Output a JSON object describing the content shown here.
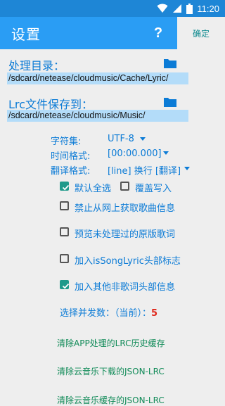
{
  "status_bar": {
    "time": "11:20",
    "icons": [
      "wifi-icon",
      "signal-icon",
      "battery-icon"
    ]
  },
  "toolbar": {
    "title": "设置",
    "help_symbol": "?",
    "confirm_label": "确定"
  },
  "paths": {
    "process_dir_label": "处理目录：",
    "process_dir_value": "/sdcard/netease/cloudmusic/Cache/Lyric/",
    "save_dir_label": "Lrc文件保存到：",
    "save_dir_value": "/sdcard/netease/cloudmusic/Music/"
  },
  "settings": {
    "charset_label": "字符集:",
    "charset_value": "UTF-8",
    "time_format_label": "时间格式:",
    "time_format_value": "[00:00.000]",
    "translation_format_label": "翻译格式:",
    "translation_format_value": "[line] 换行 [翻译]"
  },
  "checkboxes": {
    "select_all": {
      "label": "默认全选",
      "checked": true
    },
    "overwrite": {
      "label": "覆盖写入",
      "checked": false
    },
    "no_online_fetch": {
      "label": "禁止从网上获取歌曲信息",
      "checked": false
    },
    "preview_raw": {
      "label": "预览未处理过的原版歌词",
      "checked": false
    },
    "is_song_lyric_header": {
      "label": "加入isSongLyric头部标志",
      "checked": false
    },
    "extra_header": {
      "label": "加入其他非歌词头部信息",
      "checked": true
    }
  },
  "concurrency": {
    "label": "选择并发数：（当前）：",
    "value": "5"
  },
  "actions": {
    "clear_app_cache": "清除APP处理的LRC历史缓存",
    "clear_downloaded_json_lrc": "清除云音乐下载的JSON-LRC",
    "clear_cached_json_lrc": "清除云音乐缓存的JSON-LRC"
  },
  "colors": {
    "accent": "#2a9df4",
    "label_blue": "#0b7bd6",
    "checkbox_teal": "#1f9a8b",
    "link_green": "#0f8a57",
    "count_red": "#e0261a"
  }
}
